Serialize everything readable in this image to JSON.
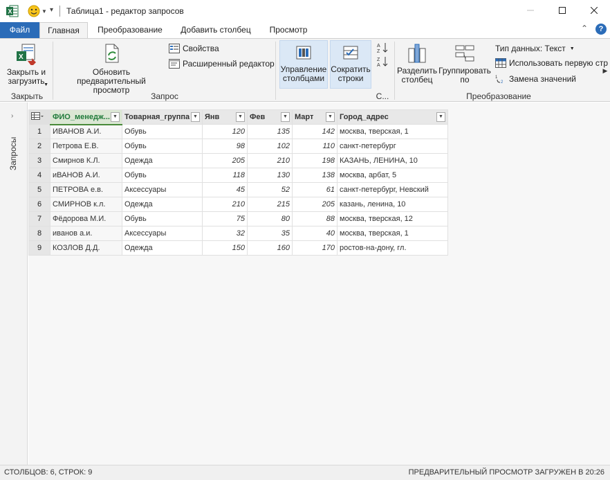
{
  "window": {
    "title": "Таблица1 - редактор запросов"
  },
  "tabs": {
    "file": "Файл",
    "home": "Главная",
    "transform": "Преобразование",
    "add_column": "Добавить столбец",
    "view": "Просмотр"
  },
  "ribbon": {
    "close_load": "Закрыть и загрузить",
    "close_group": "Закрыть",
    "refresh_preview": "Обновить предварительный просмотр",
    "properties": "Свойства",
    "advanced_editor": "Расширенный редактор",
    "query_group": "Запрос",
    "manage_columns": "Управление столбцами",
    "reduce_rows": "Сократить строки",
    "sort_group": "С...",
    "split_column": "Разделить столбец",
    "group_by": "Группировать по",
    "data_type": "Тип данных: Текст",
    "use_first_row": "Использовать первую стр",
    "replace_values": "Замена значений",
    "transform_group": "Преобразование"
  },
  "sidepanel": {
    "label": "Запросы"
  },
  "table": {
    "columns": [
      "ФИО_менедж...",
      "Товарная_группа",
      "Янв",
      "Фев",
      "Март",
      "Город_адрес"
    ],
    "rows": [
      [
        "1",
        "ИВАНОВ А.И.",
        "Обувь",
        "120",
        "135",
        "142",
        "москва, тверская, 1"
      ],
      [
        "2",
        "Петрова Е.В.",
        "Обувь",
        "98",
        "102",
        "110",
        "санкт-петербург"
      ],
      [
        "3",
        "Смирнов К.Л.",
        "Одежда",
        "205",
        "210",
        "198",
        "КАЗАНЬ, ЛЕНИНА, 10"
      ],
      [
        "4",
        "иВАНОВ А.И.",
        "Обувь",
        "118",
        "130",
        "138",
        "москва, арбат, 5"
      ],
      [
        "5",
        "ПЕТРОВА е.в.",
        "Аксессуары",
        "45",
        "52",
        "61",
        "санкт-петербург, Невский"
      ],
      [
        "6",
        "СМИРНОВ к.л.",
        "Одежда",
        "210",
        "215",
        "205",
        "казань, ленина, 10"
      ],
      [
        "7",
        "Фёдорова М.И.",
        "Обувь",
        "75",
        "80",
        "88",
        "москва, тверская, 12"
      ],
      [
        "8",
        "иванов а.и.",
        "Аксессуары",
        "32",
        "35",
        "40",
        "москва, тверская, 1"
      ],
      [
        "9",
        "КОЗЛОВ Д.Д.",
        "Одежда",
        "150",
        "160",
        "170",
        "ростов-на-дону, гл."
      ]
    ]
  },
  "status": {
    "left": "СТОЛБЦОВ: 6, СТРОК: 9",
    "right": "ПРЕДВАРИТЕЛЬНЫЙ ПРОСМОТР ЗАГРУЖЕН В 20:26"
  },
  "colors": {
    "file_tab": "#2b6cb8",
    "excel_green": "#217346",
    "selected_header": "#1f7a3a"
  }
}
